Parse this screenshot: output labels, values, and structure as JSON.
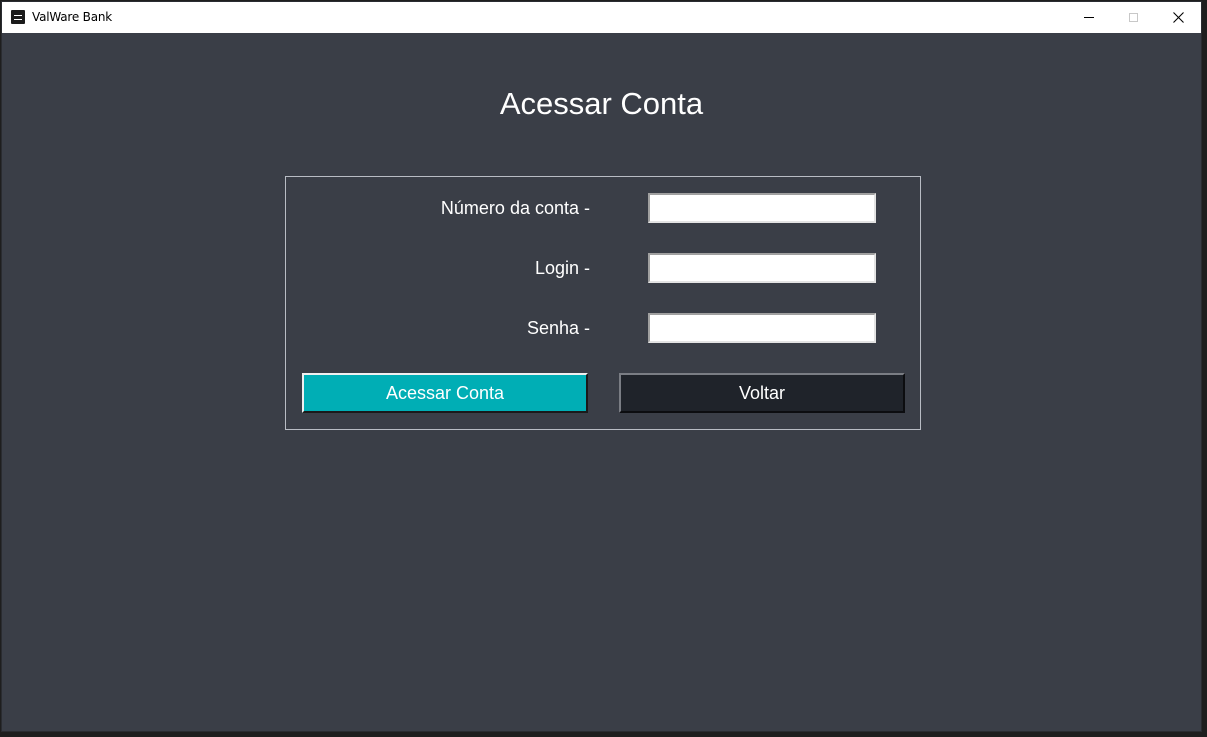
{
  "window": {
    "title": "ValWare Bank",
    "controls": {
      "minimize_icon": "minimize-icon",
      "maximize_icon": "maximize-icon",
      "close_icon": "close-icon"
    }
  },
  "page": {
    "heading": "Acessar Conta"
  },
  "form": {
    "fields": [
      {
        "label": "Número da conta -",
        "value": "",
        "placeholder": ""
      },
      {
        "label": "Login -",
        "value": "",
        "placeholder": ""
      },
      {
        "label": "Senha -",
        "value": "",
        "placeholder": ""
      }
    ],
    "submit_label": "Acessar Conta",
    "back_label": "Voltar"
  },
  "colors": {
    "background": "#3a3e47",
    "primary_button": "#00aeb5",
    "secondary_button": "#1f232a",
    "text": "#ffffff"
  }
}
